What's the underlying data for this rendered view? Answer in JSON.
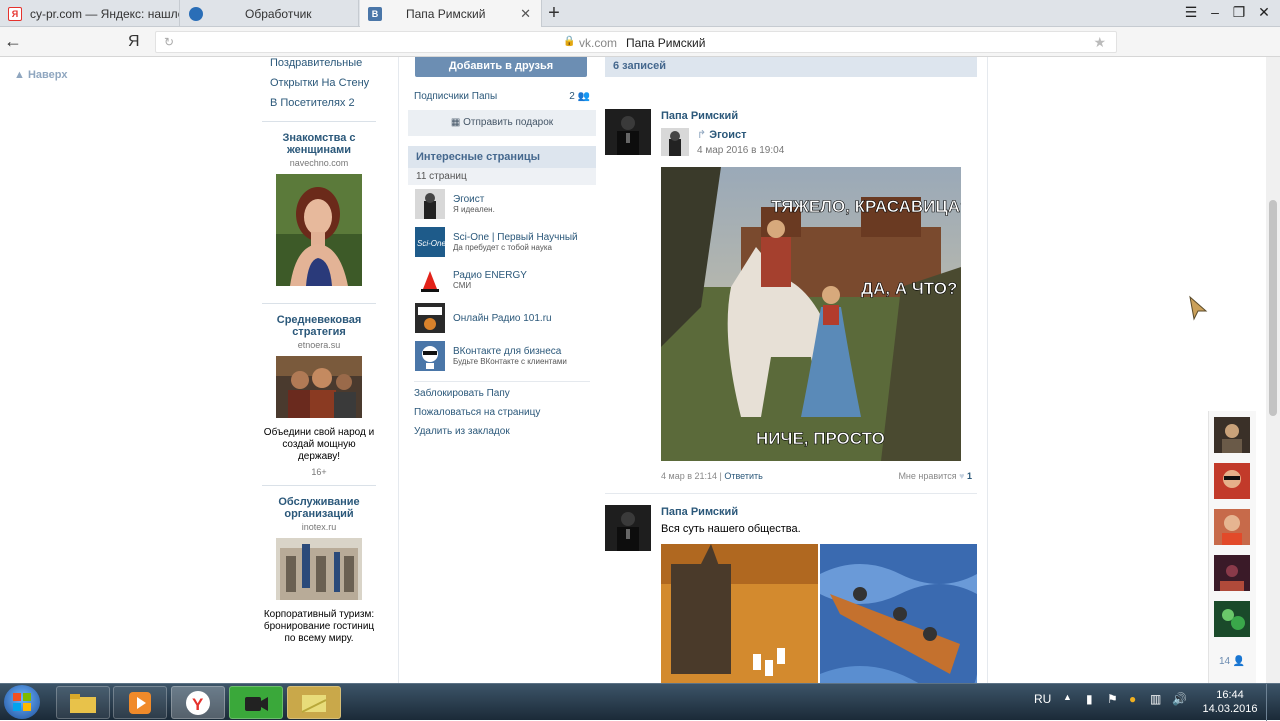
{
  "browser": {
    "tabs": [
      {
        "label": "cy-pr.com — Яндекс: нашлось",
        "favicon": "yandex-icon",
        "favicon_text": "Я",
        "favicon_color": "#e5322d"
      },
      {
        "label": "Обработчик",
        "favicon": "browser-icon",
        "favicon_color": "#2a6eb7"
      },
      {
        "label": "Папа Римский",
        "favicon": "vk-icon",
        "favicon_text": "B",
        "favicon_color": "#4a76a8",
        "active": true
      }
    ],
    "new_tab": "+",
    "back": "←",
    "yandex": "Я",
    "address_host": "vk.com",
    "address_title": "Папа Римский"
  },
  "page": {
    "to_top": "Наверх",
    "left_menu": [
      "Поздравительные",
      "Открытки На Стену",
      "В Посетителях 2"
    ],
    "ads": [
      {
        "title": "Знакомства с женщинами",
        "domain": "navechno.com",
        "desc": "",
        "age": ""
      },
      {
        "title": "Средневековая стратегия",
        "domain": "etnoera.su",
        "desc": "Объедини свой народ и создай мощную державу!",
        "age": "16+"
      },
      {
        "title": "Обслуживание организаций",
        "domain": "inotex.ru",
        "desc": "Корпоративный туризм: бронирование гостиниц по всему миру.",
        "age": ""
      }
    ],
    "profile": {
      "add_friend": "Добавить в друзья",
      "subscribers_label": "Подписчики Папы",
      "subscribers_count": "2",
      "send_gift": "Отправить подарок",
      "interesting_title": "Интересные страницы",
      "interesting_count": "11 страниц",
      "interesting": [
        {
          "name": "Эгоист",
          "sub": "Я идеален."
        },
        {
          "name": "Sci-One | Первый Научный",
          "sub": "Да пребудет с тобой наука"
        },
        {
          "name": "Радио ENERGY",
          "sub": "СМИ"
        },
        {
          "name": "Онлайн Радио 101.ru",
          "sub": ""
        },
        {
          "name": "ВКонтакте для бизнеса",
          "sub": "Будьте ВКонтакте с клиентами"
        }
      ],
      "links": [
        "Заблокировать Папу",
        "Пожаловаться на страницу",
        "Удалить из закладок"
      ]
    },
    "wall": {
      "header": "6 записей",
      "posts": [
        {
          "author": "Папа Римский",
          "repost_name": "Эгоист",
          "repost_date": "4 мар 2016 в 19:04",
          "image_text_1": "ТЯЖЕЛО, КРАСАВИЦА?",
          "image_text_2": "ДА, А ЧТО?",
          "image_text_3": "НИЧЕ, ПРОСТО",
          "date": "4 мар в 21:14",
          "reply": "Ответить",
          "like_label": "Мне нравится",
          "like_count": "1"
        },
        {
          "author": "Папа Римский",
          "text": "Вся суть нашего общества."
        }
      ]
    },
    "friends_count": "14"
  },
  "taskbar": {
    "lang": "RU",
    "time": "16:44",
    "date": "14.03.2016"
  }
}
